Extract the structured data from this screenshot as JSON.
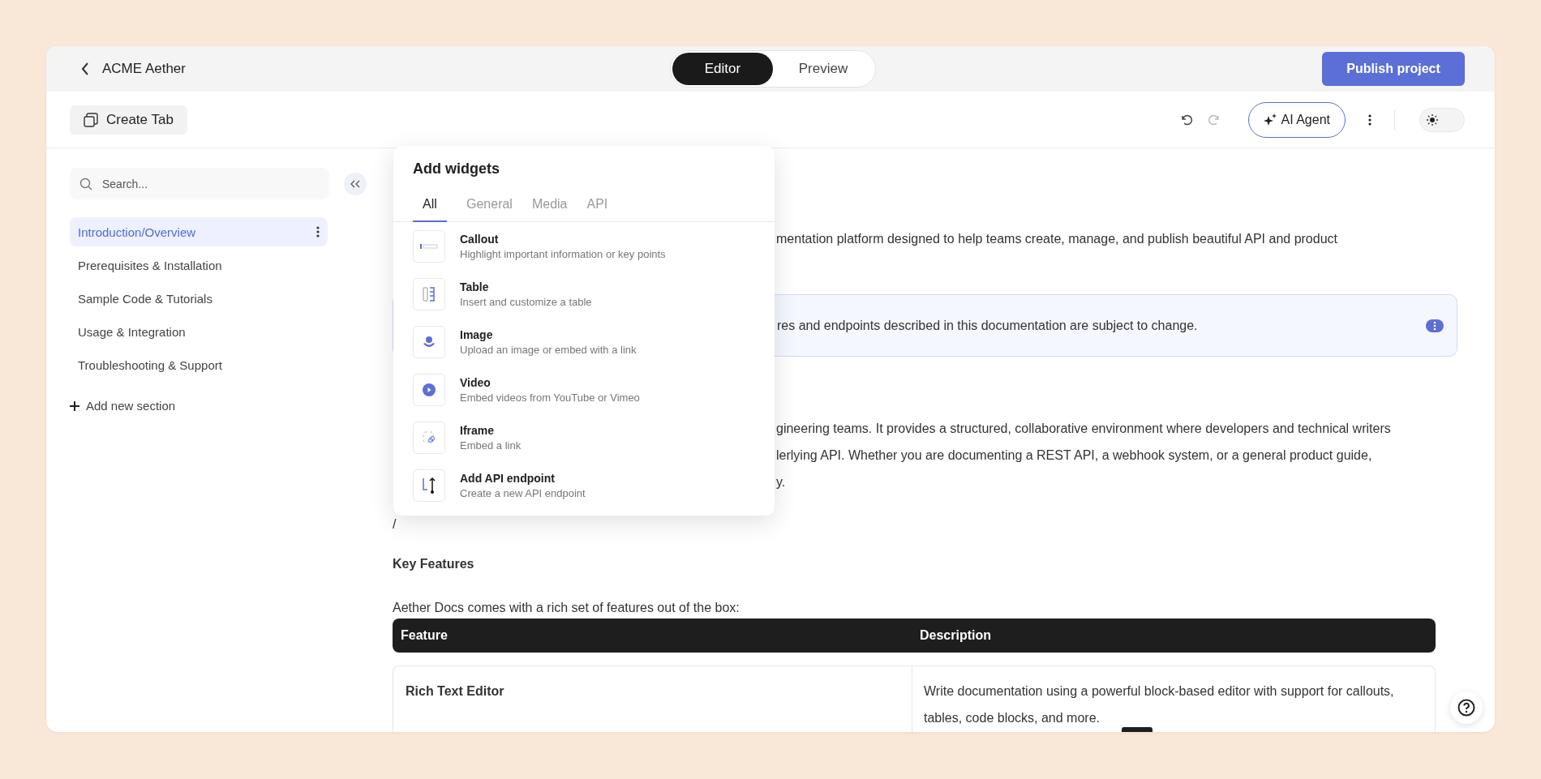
{
  "header": {
    "project_name": "ACME Aether",
    "modes": [
      {
        "label": "Editor",
        "selected": true
      },
      {
        "label": "Preview",
        "selected": false
      }
    ],
    "publish_button": "Publish project"
  },
  "toolbar": {
    "create_tab": "Create Tab",
    "ai_agent": "AI Agent",
    "dark_mode": false
  },
  "sidebar": {
    "search_placeholder": "Search...",
    "sections": [
      {
        "label": "Introduction/Overview",
        "selected": true
      },
      {
        "label": "Prerequisites & Installation",
        "selected": false
      },
      {
        "label": "Sample Code & Tutorials",
        "selected": false
      },
      {
        "label": "Usage & Integration",
        "selected": false
      },
      {
        "label": "Troubleshooting & Support",
        "selected": false
      }
    ],
    "add_section": "Add new section"
  },
  "widgets_menu": {
    "title": "Add widgets",
    "tabs": [
      {
        "label": "All",
        "selected": true
      },
      {
        "label": "General",
        "selected": false
      },
      {
        "label": "Media",
        "selected": false
      },
      {
        "label": "API",
        "selected": false
      }
    ],
    "items": [
      {
        "kind": "callout",
        "title": "Callout",
        "description": "Highlight important information or key points"
      },
      {
        "kind": "table",
        "title": "Table",
        "description": "Insert and customize a table"
      },
      {
        "kind": "image",
        "title": "Image",
        "description": "Upload an image or embed with a link"
      },
      {
        "kind": "video",
        "title": "Video",
        "description": "Embed videos from YouTube or Vimeo"
      },
      {
        "kind": "iframe",
        "title": "Iframe",
        "description": "Embed a link"
      },
      {
        "kind": "api",
        "title": "Add API endpoint",
        "description": "Create a new API endpoint"
      }
    ]
  },
  "content": {
    "paragraph_1": [
      "mentation platform designed to help teams create, manage, and publish beautiful API and product"
    ],
    "callout": "res and endpoints described in this documentation are subject to change.",
    "paragraph_2": [
      "gineering teams. It provides a structured, collaborative environment where developers and technical writers",
      "lerlying API. Whether you are documenting a REST API, a webhook system, or a general product guide,",
      "y."
    ],
    "slash": "/",
    "heading": "Key Features",
    "intro": "Aether Docs comes with a rich set of features out of the box:",
    "table": {
      "columns": [
        "Feature",
        "Description"
      ],
      "rows": [
        {
          "feature": "Rich Text Editor",
          "description": "Write documentation using a powerful block-based editor with support for callouts, tables, code blocks, and more."
        }
      ]
    }
  }
}
